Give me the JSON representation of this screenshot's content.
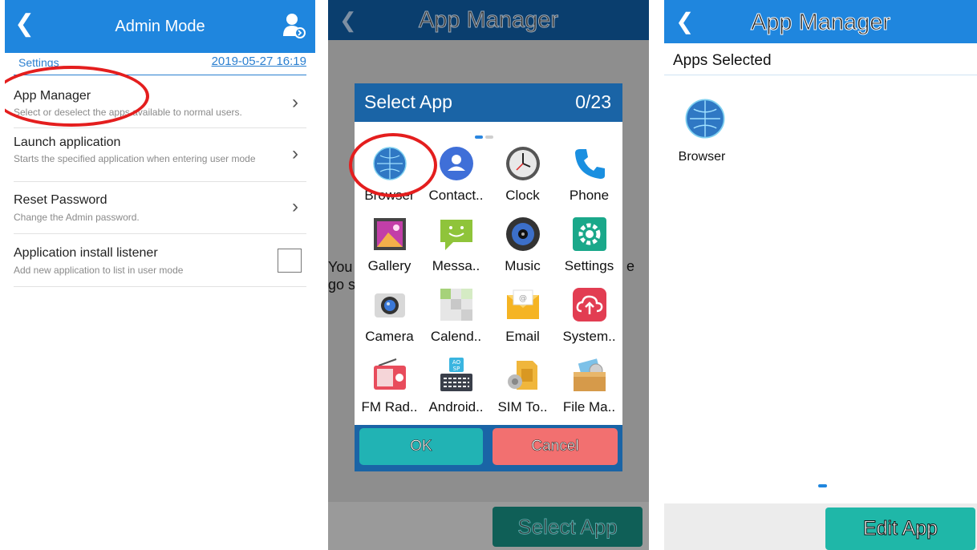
{
  "admin_mode": {
    "title": "Admin Mode",
    "settings_label": "Settings",
    "datetime": "2019-05-27 16:19",
    "rows": [
      {
        "title": "App Manager",
        "subtitle": "Select or deselect the apps available to normal users."
      },
      {
        "title": "Launch application",
        "subtitle": "Starts the specified application when entering user mode"
      },
      {
        "title": "Reset Password",
        "subtitle": "Change the Admin password."
      },
      {
        "title": "Application install listener",
        "subtitle": "Add new application to list in user mode",
        "checked": false
      }
    ]
  },
  "app_manager_dialog": {
    "header_title": "App Manager",
    "background_text_left": "You\ngo s",
    "background_text_right": "e",
    "select_app_button": "Select App",
    "dialog_title": "Select App",
    "selected_count": "0/23",
    "apps": [
      {
        "label": "Browser",
        "icon": "globe-icon"
      },
      {
        "label": "Contact..",
        "icon": "contact-icon"
      },
      {
        "label": "Clock",
        "icon": "clock-icon"
      },
      {
        "label": "Phone",
        "icon": "phone-icon"
      },
      {
        "label": "Gallery",
        "icon": "gallery-icon"
      },
      {
        "label": "Messa..",
        "icon": "message-icon"
      },
      {
        "label": "Music",
        "icon": "music-icon"
      },
      {
        "label": "Settings",
        "icon": "gear-icon"
      },
      {
        "label": "Camera",
        "icon": "camera-icon"
      },
      {
        "label": "Calend..",
        "icon": "calendar-icon"
      },
      {
        "label": "Email",
        "icon": "email-icon"
      },
      {
        "label": "System..",
        "icon": "cloud-upload-icon"
      },
      {
        "label": "FM Rad..",
        "icon": "radio-icon"
      },
      {
        "label": "Android..",
        "icon": "keyboard-icon"
      },
      {
        "label": "SIM To..",
        "icon": "sim-icon"
      },
      {
        "label": "File Ma..",
        "icon": "file-manager-icon"
      }
    ],
    "ok_label": "OK",
    "cancel_label": "Cancel"
  },
  "app_manager_result": {
    "header_title": "App Manager",
    "section_title": "Apps Selected",
    "selected_apps": [
      {
        "label": "Browser",
        "icon": "globe-icon"
      }
    ],
    "edit_button": "Edit App"
  },
  "colors": {
    "header_blue": "#1f86de",
    "dialog_blue": "#1a64a6",
    "ok_teal": "#21b3b4",
    "cancel_red": "#f27070",
    "edit_teal": "#1fb7a8",
    "highlight_red": "#e41e1e"
  }
}
